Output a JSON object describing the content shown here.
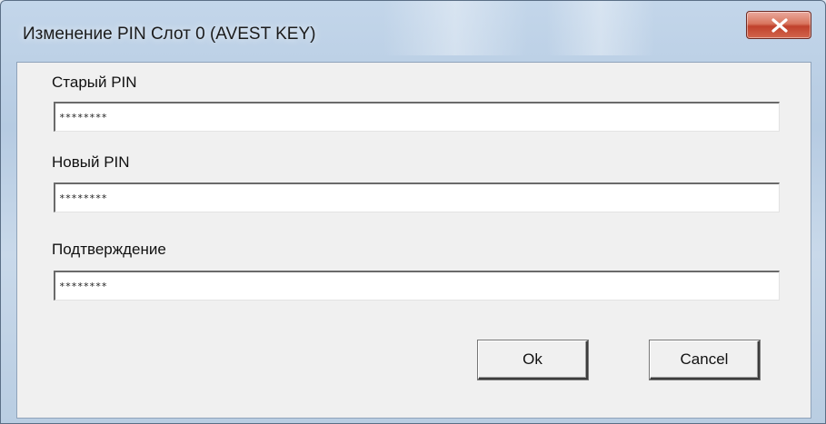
{
  "dialog": {
    "title": "Изменение PIN Слот 0 (AVEST KEY)",
    "close_icon": "close-icon"
  },
  "fields": [
    {
      "label": "Старый PIN",
      "value": "********"
    },
    {
      "label": "Новый PIN",
      "value": "********"
    },
    {
      "label": "Подтверждение",
      "value": "********"
    }
  ],
  "buttons": {
    "ok_label": "Ok",
    "cancel_label": "Cancel"
  },
  "colors": {
    "client_background": "#f0f0f0",
    "close_button": "#c0412c"
  }
}
